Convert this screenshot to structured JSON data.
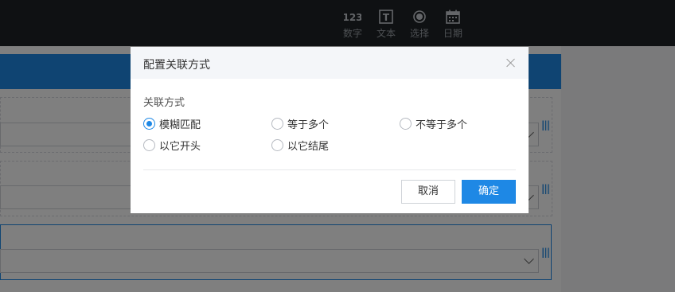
{
  "toolbar": {
    "items": [
      {
        "label": "数字",
        "icon": "number-icon",
        "glyph": "123"
      },
      {
        "label": "文本",
        "icon": "text-icon",
        "glyph": "T"
      },
      {
        "label": "选择",
        "icon": "radio-select-icon",
        "glyph": ""
      },
      {
        "label": "日期",
        "icon": "calendar-icon",
        "glyph": ""
      }
    ]
  },
  "dialog": {
    "title": "配置关联方式",
    "section_label": "关联方式",
    "options": [
      {
        "label": "模糊匹配",
        "checked": true
      },
      {
        "label": "等于多个",
        "checked": false
      },
      {
        "label": "不等于多个",
        "checked": false
      },
      {
        "label": "以它开头",
        "checked": false
      },
      {
        "label": "以它结尾",
        "checked": false
      }
    ],
    "cancel_label": "取消",
    "ok_label": "确定"
  },
  "colors": {
    "accent": "#1e88e5",
    "topbar": "#1f2327",
    "overlay": "rgba(0,0,0,0.5)"
  }
}
